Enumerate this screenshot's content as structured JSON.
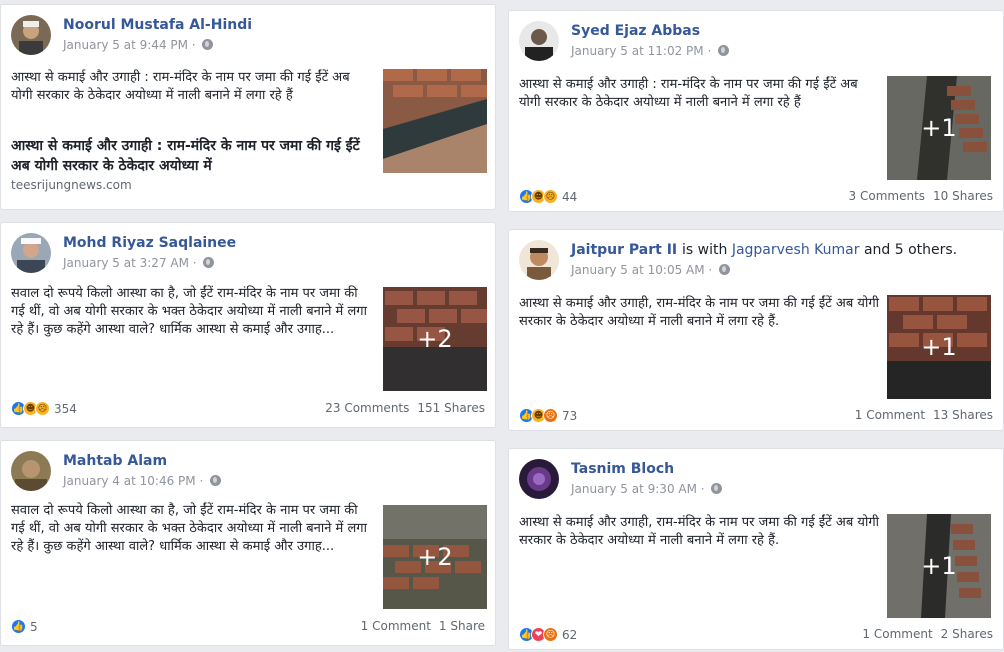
{
  "posts": [
    {
      "author": "Noorul Mustafa Al-Hindi",
      "time": "January 5 at 9:44 PM",
      "text": "आस्था से कमाई और उगाही : राम-मंदिर के नाम पर जमा की गई ईंटें अब योगी सरकार के ठेकेदार अयोध्या में नाली बनाने में लगा रहे हैं",
      "link_title": "आस्था से कमाई और उगाही : राम-मंदिर के नाम पर जमा की गई ईंटें अब योगी सरकार के ठेकेदार अयोध्या में",
      "link_domain": "teesrijungnews.com"
    },
    {
      "author": "Mohd Riyaz Saqlainee",
      "time": "January 5 at 3:27 AM",
      "text": "सवाल दो रूपये किलो आस्था का है, जो ईंटें राम-मंदिर के नाम पर जमा की गई थीं, वो अब योगी सरकार के भक्त ठेकेदार अयोध्या में नाली बनाने में लगा रहे हैं। कुछ कहेंगे आस्था वाले? धार्मिक आस्था से कमाई और उगाह...",
      "photo_more": "+2",
      "reaction_count": "354",
      "comments": "23 Comments",
      "shares": "151 Shares"
    },
    {
      "author": "Mahtab Alam",
      "time": "January 4 at 10:46 PM",
      "text": "सवाल दो रूपये किलो आस्था का है, जो ईंटें राम-मंदिर के नाम पर जमा की गई थीं, वो अब योगी सरकार के भक्त ठेकेदार अयोध्या में नाली बनाने में लगा रहे हैं। कुछ कहेंगे आस्था वाले? धार्मिक आस्था से कमाई और उगाह...",
      "photo_more": "+2",
      "reaction_count": "5",
      "comments": "1 Comment",
      "shares": "1 Share"
    },
    {
      "author": "Syed Ejaz Abbas",
      "time": "January 5 at 11:02 PM",
      "text": "आस्था से कमाई और उगाही : राम-मंदिर के नाम पर जमा की गई ईंटें अब योगी सरकार के ठेकेदार अयोध्या में नाली बनाने में लगा रहे हैं",
      "photo_more": "+1",
      "reaction_count": "44",
      "comments": "3 Comments",
      "shares": "10 Shares"
    },
    {
      "author": "Jaitpur Part II",
      "with_prefix": "is with",
      "with_name": "Jagparvesh Kumar",
      "with_suffix": "and 5 others.",
      "time": "January 5 at 10:05 AM",
      "text": "आस्था से कमाई और उगाही, राम-मंदिर के नाम पर जमा की गई ईंटें अब योगी सरकार के ठेकेदार अयोध्या में नाली बनाने में लगा रहे हैं.",
      "photo_more": "+1",
      "reaction_count": "73",
      "comments": "1 Comment",
      "shares": "13 Shares"
    },
    {
      "author": "Tasnim Bloch",
      "time": "January 5 at 9:30 AM",
      "text": "आस्था से कमाई और उगाही, राम-मंदिर के नाम पर जमा की गई ईंटें अब योगी सरकार के ठेकेदार अयोध्या में नाली बनाने में लगा रहे हैं.",
      "photo_more": "+1",
      "reaction_count": "62",
      "comments": "1 Comment",
      "shares": "2 Shares"
    }
  ],
  "colors": {
    "link": "#365899",
    "meta": "#90949c",
    "bg": "#e9ebee"
  },
  "icons": [
    "globe-icon",
    "like-reaction-icon",
    "haha-reaction-icon",
    "sad-reaction-icon",
    "angry-reaction-icon",
    "love-reaction-icon"
  ]
}
